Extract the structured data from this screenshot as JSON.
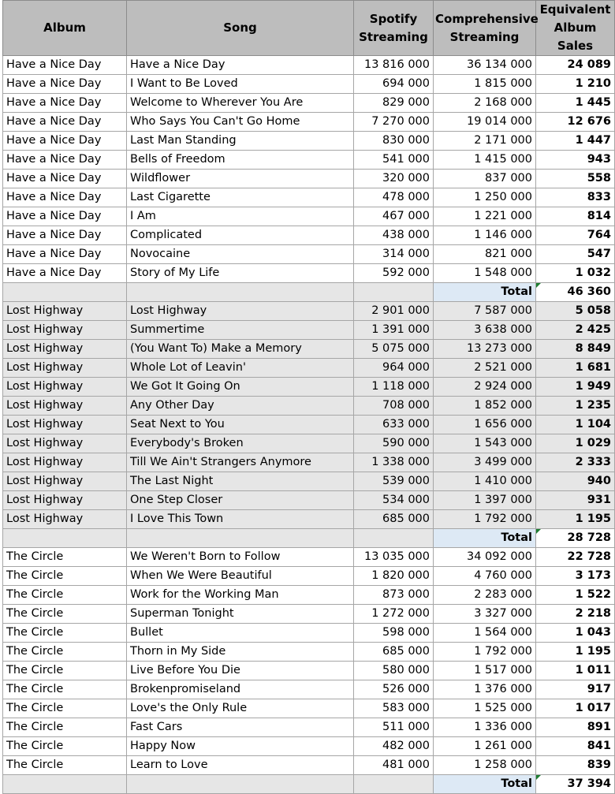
{
  "headers": {
    "album": "Album",
    "song": "Song",
    "spotify": [
      "Spotify",
      "Streaming"
    ],
    "comprehensive": [
      "Comprehensive",
      "Streaming"
    ],
    "equivalent": [
      "Equivalent",
      "Album Sales"
    ]
  },
  "total_label": "Total",
  "colors": {
    "header_bg": "#bdbdbd",
    "gray_rows": "#e6e6e6",
    "total_label_bg": "#dde9f5",
    "note_marker": "#1e7d32"
  },
  "groups": [
    {
      "album": "Have a Nice Day",
      "total": "46 360",
      "rows": [
        {
          "album": "Have a Nice Day",
          "song": "Have a Nice Day",
          "spotify": "13 816 000",
          "comprehensive": "36 134 000",
          "equivalent": "24 089"
        },
        {
          "album": "Have a Nice Day",
          "song": "I Want to Be Loved",
          "spotify": "694 000",
          "comprehensive": "1 815 000",
          "equivalent": "1 210"
        },
        {
          "album": "Have a Nice Day",
          "song": "Welcome to Wherever You Are",
          "spotify": "829 000",
          "comprehensive": "2 168 000",
          "equivalent": "1 445"
        },
        {
          "album": "Have a Nice Day",
          "song": "Who Says You Can't Go Home",
          "spotify": "7 270 000",
          "comprehensive": "19 014 000",
          "equivalent": "12 676"
        },
        {
          "album": "Have a Nice Day",
          "song": "Last Man Standing",
          "spotify": "830 000",
          "comprehensive": "2 171 000",
          "equivalent": "1 447"
        },
        {
          "album": "Have a Nice Day",
          "song": "Bells of Freedom",
          "spotify": "541 000",
          "comprehensive": "1 415 000",
          "equivalent": "943"
        },
        {
          "album": "Have a Nice Day",
          "song": "Wildflower",
          "spotify": "320 000",
          "comprehensive": "837 000",
          "equivalent": "558"
        },
        {
          "album": "Have a Nice Day",
          "song": "Last Cigarette",
          "spotify": "478 000",
          "comprehensive": "1 250 000",
          "equivalent": "833"
        },
        {
          "album": "Have a Nice Day",
          "song": "I Am",
          "spotify": "467 000",
          "comprehensive": "1 221 000",
          "equivalent": "814"
        },
        {
          "album": "Have a Nice Day",
          "song": "Complicated",
          "spotify": "438 000",
          "comprehensive": "1 146 000",
          "equivalent": "764"
        },
        {
          "album": "Have a Nice Day",
          "song": "Novocaine",
          "spotify": "314 000",
          "comprehensive": "821 000",
          "equivalent": "547"
        },
        {
          "album": "Have a Nice Day",
          "song": "Story of My Life",
          "spotify": "592 000",
          "comprehensive": "1 548 000",
          "equivalent": "1 032"
        }
      ]
    },
    {
      "album": "Lost Highway",
      "total": "28 728",
      "rows": [
        {
          "album": "Lost Highway",
          "song": "Lost Highway",
          "spotify": "2 901 000",
          "comprehensive": "7 587 000",
          "equivalent": "5 058"
        },
        {
          "album": "Lost Highway",
          "song": "Summertime",
          "spotify": "1 391 000",
          "comprehensive": "3 638 000",
          "equivalent": "2 425"
        },
        {
          "album": "Lost Highway",
          "song": "(You Want To) Make a Memory",
          "spotify": "5 075 000",
          "comprehensive": "13 273 000",
          "equivalent": "8 849"
        },
        {
          "album": "Lost Highway",
          "song": "Whole Lot of Leavin'",
          "spotify": "964 000",
          "comprehensive": "2 521 000",
          "equivalent": "1 681"
        },
        {
          "album": "Lost Highway",
          "song": "We Got It Going On",
          "spotify": "1 118 000",
          "comprehensive": "2 924 000",
          "equivalent": "1 949"
        },
        {
          "album": "Lost Highway",
          "song": "Any Other Day",
          "spotify": "708 000",
          "comprehensive": "1 852 000",
          "equivalent": "1 235"
        },
        {
          "album": "Lost Highway",
          "song": "Seat Next to You",
          "spotify": "633 000",
          "comprehensive": "1 656 000",
          "equivalent": "1 104"
        },
        {
          "album": "Lost Highway",
          "song": "Everybody's Broken",
          "spotify": "590 000",
          "comprehensive": "1 543 000",
          "equivalent": "1 029"
        },
        {
          "album": "Lost Highway",
          "song": "Till We Ain't Strangers Anymore",
          "spotify": "1 338 000",
          "comprehensive": "3 499 000",
          "equivalent": "2 333"
        },
        {
          "album": "Lost Highway",
          "song": "The Last Night",
          "spotify": "539 000",
          "comprehensive": "1 410 000",
          "equivalent": "940"
        },
        {
          "album": "Lost Highway",
          "song": "One Step Closer",
          "spotify": "534 000",
          "comprehensive": "1 397 000",
          "equivalent": "931"
        },
        {
          "album": "Lost Highway",
          "song": "I Love This Town",
          "spotify": "685 000",
          "comprehensive": "1 792 000",
          "equivalent": "1 195"
        }
      ]
    },
    {
      "album": "The Circle",
      "total": "37 394",
      "rows": [
        {
          "album": "The Circle",
          "song": "We Weren't Born to Follow",
          "spotify": "13 035 000",
          "comprehensive": "34 092 000",
          "equivalent": "22 728"
        },
        {
          "album": "The Circle",
          "song": "When We Were Beautiful",
          "spotify": "1 820 000",
          "comprehensive": "4 760 000",
          "equivalent": "3 173"
        },
        {
          "album": "The Circle",
          "song": "Work for the Working Man",
          "spotify": "873 000",
          "comprehensive": "2 283 000",
          "equivalent": "1 522"
        },
        {
          "album": "The Circle",
          "song": "Superman Tonight",
          "spotify": "1 272 000",
          "comprehensive": "3 327 000",
          "equivalent": "2 218"
        },
        {
          "album": "The Circle",
          "song": "Bullet",
          "spotify": "598 000",
          "comprehensive": "1 564 000",
          "equivalent": "1 043"
        },
        {
          "album": "The Circle",
          "song": "Thorn in My Side",
          "spotify": "685 000",
          "comprehensive": "1 792 000",
          "equivalent": "1 195"
        },
        {
          "album": "The Circle",
          "song": "Live Before You Die",
          "spotify": "580 000",
          "comprehensive": "1 517 000",
          "equivalent": "1 011"
        },
        {
          "album": "The Circle",
          "song": "Brokenpromiseland",
          "spotify": "526 000",
          "comprehensive": "1 376 000",
          "equivalent": "917"
        },
        {
          "album": "The Circle",
          "song": "Love's the Only Rule",
          "spotify": "583 000",
          "comprehensive": "1 525 000",
          "equivalent": "1 017"
        },
        {
          "album": "The Circle",
          "song": "Fast Cars",
          "spotify": "511 000",
          "comprehensive": "1 336 000",
          "equivalent": "891"
        },
        {
          "album": "The Circle",
          "song": "Happy Now",
          "spotify": "482 000",
          "comprehensive": "1 261 000",
          "equivalent": "841"
        },
        {
          "album": "The Circle",
          "song": "Learn to Love",
          "spotify": "481 000",
          "comprehensive": "1 258 000",
          "equivalent": "839"
        }
      ]
    }
  ]
}
